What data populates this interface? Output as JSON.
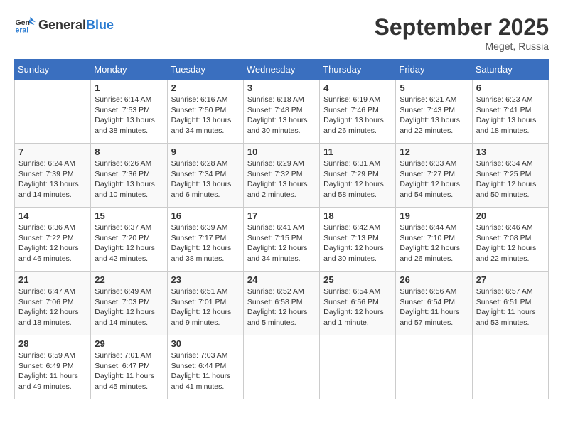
{
  "header": {
    "logo_general": "General",
    "logo_blue": "Blue",
    "month_year": "September 2025",
    "location": "Meget, Russia"
  },
  "columns": [
    "Sunday",
    "Monday",
    "Tuesday",
    "Wednesday",
    "Thursday",
    "Friday",
    "Saturday"
  ],
  "weeks": [
    [
      {
        "day": "",
        "sunrise": "",
        "sunset": "",
        "daylight": ""
      },
      {
        "day": "1",
        "sunrise": "Sunrise: 6:14 AM",
        "sunset": "Sunset: 7:53 PM",
        "daylight": "Daylight: 13 hours and 38 minutes."
      },
      {
        "day": "2",
        "sunrise": "Sunrise: 6:16 AM",
        "sunset": "Sunset: 7:50 PM",
        "daylight": "Daylight: 13 hours and 34 minutes."
      },
      {
        "day": "3",
        "sunrise": "Sunrise: 6:18 AM",
        "sunset": "Sunset: 7:48 PM",
        "daylight": "Daylight: 13 hours and 30 minutes."
      },
      {
        "day": "4",
        "sunrise": "Sunrise: 6:19 AM",
        "sunset": "Sunset: 7:46 PM",
        "daylight": "Daylight: 13 hours and 26 minutes."
      },
      {
        "day": "5",
        "sunrise": "Sunrise: 6:21 AM",
        "sunset": "Sunset: 7:43 PM",
        "daylight": "Daylight: 13 hours and 22 minutes."
      },
      {
        "day": "6",
        "sunrise": "Sunrise: 6:23 AM",
        "sunset": "Sunset: 7:41 PM",
        "daylight": "Daylight: 13 hours and 18 minutes."
      }
    ],
    [
      {
        "day": "7",
        "sunrise": "Sunrise: 6:24 AM",
        "sunset": "Sunset: 7:39 PM",
        "daylight": "Daylight: 13 hours and 14 minutes."
      },
      {
        "day": "8",
        "sunrise": "Sunrise: 6:26 AM",
        "sunset": "Sunset: 7:36 PM",
        "daylight": "Daylight: 13 hours and 10 minutes."
      },
      {
        "day": "9",
        "sunrise": "Sunrise: 6:28 AM",
        "sunset": "Sunset: 7:34 PM",
        "daylight": "Daylight: 13 hours and 6 minutes."
      },
      {
        "day": "10",
        "sunrise": "Sunrise: 6:29 AM",
        "sunset": "Sunset: 7:32 PM",
        "daylight": "Daylight: 13 hours and 2 minutes."
      },
      {
        "day": "11",
        "sunrise": "Sunrise: 6:31 AM",
        "sunset": "Sunset: 7:29 PM",
        "daylight": "Daylight: 12 hours and 58 minutes."
      },
      {
        "day": "12",
        "sunrise": "Sunrise: 6:33 AM",
        "sunset": "Sunset: 7:27 PM",
        "daylight": "Daylight: 12 hours and 54 minutes."
      },
      {
        "day": "13",
        "sunrise": "Sunrise: 6:34 AM",
        "sunset": "Sunset: 7:25 PM",
        "daylight": "Daylight: 12 hours and 50 minutes."
      }
    ],
    [
      {
        "day": "14",
        "sunrise": "Sunrise: 6:36 AM",
        "sunset": "Sunset: 7:22 PM",
        "daylight": "Daylight: 12 hours and 46 minutes."
      },
      {
        "day": "15",
        "sunrise": "Sunrise: 6:37 AM",
        "sunset": "Sunset: 7:20 PM",
        "daylight": "Daylight: 12 hours and 42 minutes."
      },
      {
        "day": "16",
        "sunrise": "Sunrise: 6:39 AM",
        "sunset": "Sunset: 7:17 PM",
        "daylight": "Daylight: 12 hours and 38 minutes."
      },
      {
        "day": "17",
        "sunrise": "Sunrise: 6:41 AM",
        "sunset": "Sunset: 7:15 PM",
        "daylight": "Daylight: 12 hours and 34 minutes."
      },
      {
        "day": "18",
        "sunrise": "Sunrise: 6:42 AM",
        "sunset": "Sunset: 7:13 PM",
        "daylight": "Daylight: 12 hours and 30 minutes."
      },
      {
        "day": "19",
        "sunrise": "Sunrise: 6:44 AM",
        "sunset": "Sunset: 7:10 PM",
        "daylight": "Daylight: 12 hours and 26 minutes."
      },
      {
        "day": "20",
        "sunrise": "Sunrise: 6:46 AM",
        "sunset": "Sunset: 7:08 PM",
        "daylight": "Daylight: 12 hours and 22 minutes."
      }
    ],
    [
      {
        "day": "21",
        "sunrise": "Sunrise: 6:47 AM",
        "sunset": "Sunset: 7:06 PM",
        "daylight": "Daylight: 12 hours and 18 minutes."
      },
      {
        "day": "22",
        "sunrise": "Sunrise: 6:49 AM",
        "sunset": "Sunset: 7:03 PM",
        "daylight": "Daylight: 12 hours and 14 minutes."
      },
      {
        "day": "23",
        "sunrise": "Sunrise: 6:51 AM",
        "sunset": "Sunset: 7:01 PM",
        "daylight": "Daylight: 12 hours and 9 minutes."
      },
      {
        "day": "24",
        "sunrise": "Sunrise: 6:52 AM",
        "sunset": "Sunset: 6:58 PM",
        "daylight": "Daylight: 12 hours and 5 minutes."
      },
      {
        "day": "25",
        "sunrise": "Sunrise: 6:54 AM",
        "sunset": "Sunset: 6:56 PM",
        "daylight": "Daylight: 12 hours and 1 minute."
      },
      {
        "day": "26",
        "sunrise": "Sunrise: 6:56 AM",
        "sunset": "Sunset: 6:54 PM",
        "daylight": "Daylight: 11 hours and 57 minutes."
      },
      {
        "day": "27",
        "sunrise": "Sunrise: 6:57 AM",
        "sunset": "Sunset: 6:51 PM",
        "daylight": "Daylight: 11 hours and 53 minutes."
      }
    ],
    [
      {
        "day": "28",
        "sunrise": "Sunrise: 6:59 AM",
        "sunset": "Sunset: 6:49 PM",
        "daylight": "Daylight: 11 hours and 49 minutes."
      },
      {
        "day": "29",
        "sunrise": "Sunrise: 7:01 AM",
        "sunset": "Sunset: 6:47 PM",
        "daylight": "Daylight: 11 hours and 45 minutes."
      },
      {
        "day": "30",
        "sunrise": "Sunrise: 7:03 AM",
        "sunset": "Sunset: 6:44 PM",
        "daylight": "Daylight: 11 hours and 41 minutes."
      },
      {
        "day": "",
        "sunrise": "",
        "sunset": "",
        "daylight": ""
      },
      {
        "day": "",
        "sunrise": "",
        "sunset": "",
        "daylight": ""
      },
      {
        "day": "",
        "sunrise": "",
        "sunset": "",
        "daylight": ""
      },
      {
        "day": "",
        "sunrise": "",
        "sunset": "",
        "daylight": ""
      }
    ]
  ]
}
